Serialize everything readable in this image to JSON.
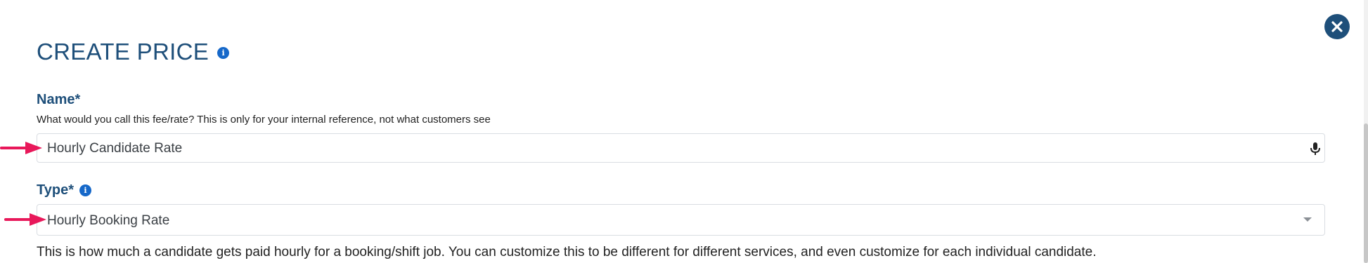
{
  "dialog": {
    "title": "CREATE PRICE",
    "title_info_icon": "info-icon",
    "close_icon": "close-icon"
  },
  "name_field": {
    "label": "Name*",
    "hint": "What would you call this fee/rate? This is only for your internal reference, not what customers see",
    "value": "Hourly Candidate Rate",
    "mic_icon": "microphone-icon"
  },
  "type_field": {
    "label": "Type*",
    "label_info_icon": "info-icon",
    "value": "Hourly Booking Rate",
    "description": "This is how much a candidate gets paid hourly for a booking/shift job. You can customize this to be different for different services, and even customize for each individual candidate."
  },
  "colors": {
    "heading": "#1e4f7a",
    "info_icon": "#1668c9",
    "annotation_arrow": "#e8185a",
    "border": "#d9dde2"
  },
  "annotations": {
    "arrow_icon": "pointer-arrow"
  }
}
